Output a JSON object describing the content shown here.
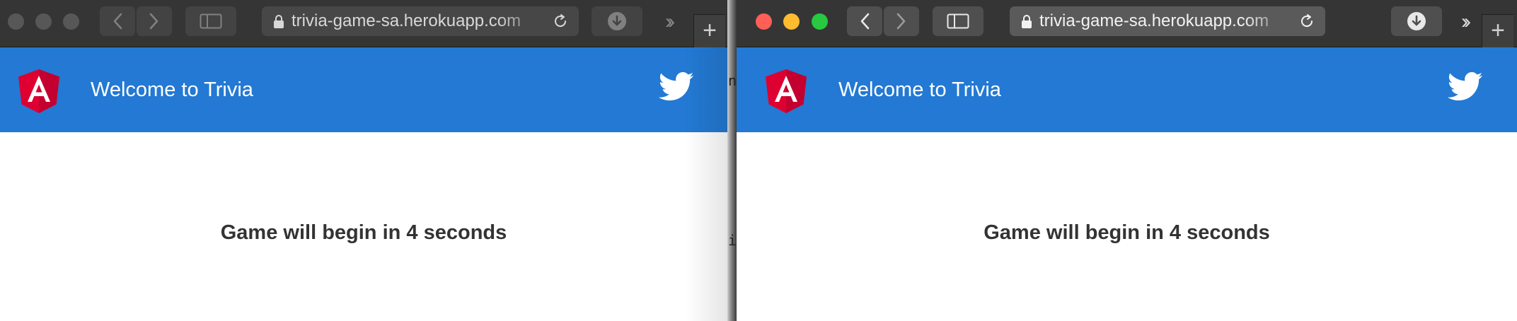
{
  "windows": [
    {
      "state": "inactive",
      "address_url": "trivia-game-sa.herokuapp.com",
      "app_title": "Welcome to Trivia",
      "message": "Game will begin in 4 seconds"
    },
    {
      "state": "active",
      "address_url": "trivia-game-sa.herokuapp.com",
      "app_title": "Welcome to Trivia",
      "message": "Game will begin in 4 seconds"
    }
  ],
  "background_window_fragments": [
    "n",
    "i"
  ],
  "icons": {
    "back": "chevron-left-icon",
    "forward": "chevron-right-icon",
    "sidebar": "sidebar-icon",
    "lock": "lock-icon",
    "reload": "reload-icon",
    "downloads": "download-icon",
    "more": "double-chevron-right-icon",
    "new_tab": "plus-icon",
    "brand": "angular-logo",
    "social": "twitter-icon"
  },
  "colors": {
    "toolbar": "#353535",
    "app_bar": "#2379d3",
    "angular_red": "#dd0031",
    "angular_dark_red": "#c3002f",
    "text_dark": "#333333",
    "close": "#fe5f57",
    "minimize": "#febc2e",
    "zoom": "#28c840"
  }
}
